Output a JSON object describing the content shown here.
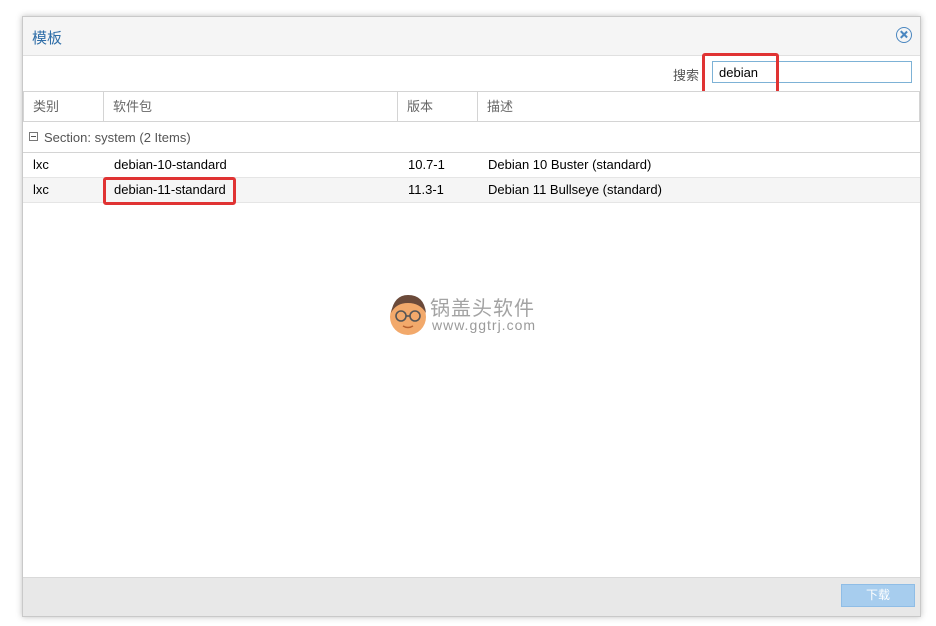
{
  "window": {
    "title": "模板"
  },
  "search": {
    "label": "搜索",
    "value": "debian"
  },
  "columns": [
    "类别",
    "软件包",
    "版本",
    "描述"
  ],
  "group": {
    "label": "Section: system (2 Items)"
  },
  "rows": [
    {
      "type": "lxc",
      "package": "debian-10-standard",
      "version": "10.7-1",
      "description": "Debian 10 Buster (standard)"
    },
    {
      "type": "lxc",
      "package": "debian-11-standard",
      "version": "11.3-1",
      "description": "Debian 11 Bullseye (standard)"
    }
  ],
  "footer": {
    "download_label": "下载"
  },
  "watermark": {
    "name": "锅盖头软件",
    "url": "www.ggtrj.com"
  },
  "colors": {
    "title": "#2f6ea8",
    "highlight": "#e03333",
    "button_disabled": "#a7cdee"
  }
}
